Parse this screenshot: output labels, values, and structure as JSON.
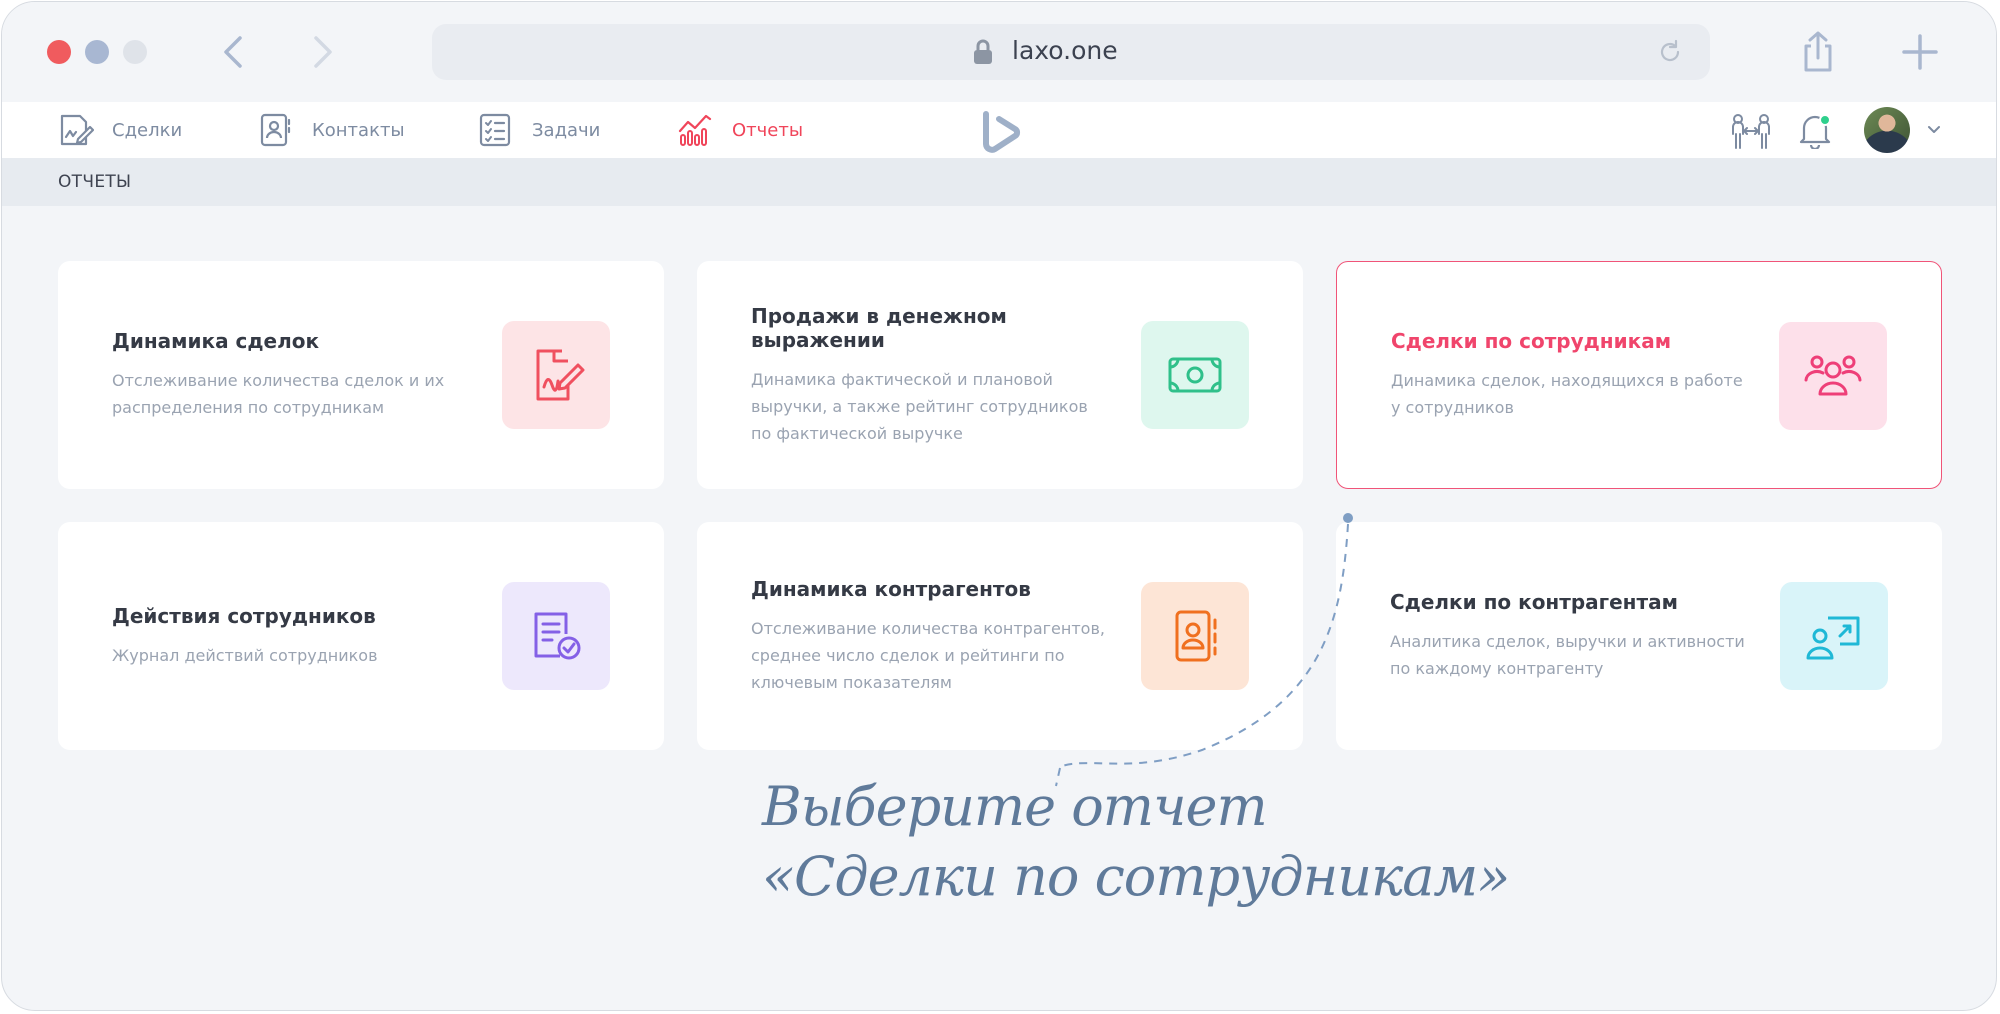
{
  "browser": {
    "url": "laxo.one"
  },
  "nav": {
    "items": [
      {
        "label": "Сделки",
        "icon": "deals-icon"
      },
      {
        "label": "Контакты",
        "icon": "contacts-icon"
      },
      {
        "label": "Задачи",
        "icon": "tasks-icon"
      },
      {
        "label": "Отчеты",
        "icon": "reports-icon",
        "active": true
      }
    ]
  },
  "breadcrumb": "ОТЧЕТЫ",
  "cards": [
    {
      "title": "Динамика сделок",
      "desc": "Отслеживание количества сделок и их распределения по сотрудникам",
      "icon": "document-signature-icon",
      "color": "#f0505f",
      "bg": "#fde4e6"
    },
    {
      "title": "Продажи в денежном выражении",
      "desc": "Динамика фактической и плановой выручки, а также рейтинг сотрудников по фактической выручке",
      "icon": "banknote-icon",
      "color": "#2fc08a",
      "bg": "#def7ee"
    },
    {
      "title": "Сделки по сотрудникам",
      "desc": "Динамика сделок, находящихся в работе у сотрудников",
      "icon": "users-group-icon",
      "color": "#ee3f78",
      "bg": "#fde0ea",
      "selected": true
    },
    {
      "title": "Действия сотрудников",
      "desc": "Журнал действий сотрудников",
      "icon": "document-check-icon",
      "color": "#8460e6",
      "bg": "#ede8fc"
    },
    {
      "title": "Динамика контрагентов",
      "desc": "Отслеживание количества контрагентов, среднее число сделок и рейтинги по ключевым показателям",
      "icon": "address-book-icon",
      "color": "#f0701f",
      "bg": "#fde5d6"
    },
    {
      "title": "Сделки по контрагентам",
      "desc": "Аналитика сделок, выручки и активности по каждому контрагенту",
      "icon": "presentation-user-icon",
      "color": "#1fb8d6",
      "bg": "#d9f4f9"
    }
  ],
  "hint": {
    "line1": "Выберите отчет",
    "line2": "«Сделки по сотрудникам»"
  },
  "colors": {
    "accent": "#f0455a",
    "muted": "#7d8ba1"
  }
}
